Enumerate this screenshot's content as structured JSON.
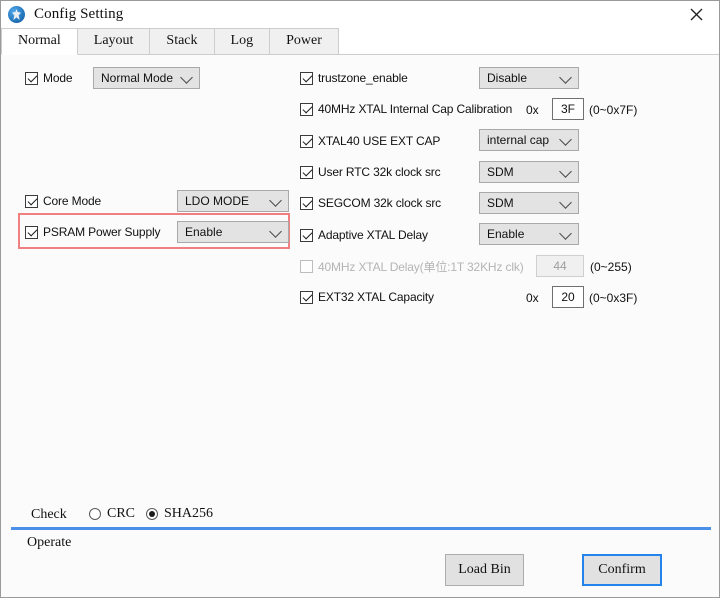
{
  "window": {
    "title": "Config Setting",
    "app_icon": "globe-icon",
    "close_icon": "close-icon"
  },
  "tabs": [
    {
      "label": "Normal",
      "active": true
    },
    {
      "label": "Layout",
      "active": false
    },
    {
      "label": "Stack",
      "active": false
    },
    {
      "label": "Log",
      "active": false
    },
    {
      "label": "Power",
      "active": false
    }
  ],
  "left_column": {
    "mode": {
      "label": "Mode",
      "checked": true,
      "value": "Normal Mode"
    },
    "core_mode": {
      "label": "Core Mode",
      "checked": true,
      "value": "LDO MODE"
    },
    "psram_power_supply": {
      "label": "PSRAM Power Supply",
      "checked": true,
      "value": "Enable",
      "highlight_color": "#f08080"
    }
  },
  "right_column": {
    "trustzone_enable": {
      "label": "trustzone_enable",
      "checked": true,
      "value": "Disable"
    },
    "xtal_internal_cap_calibration": {
      "label": "40MHz XTAL Internal Cap Calibration",
      "checked": true,
      "prefix": "0x",
      "value": "3F",
      "range": "(0~0x7F)"
    },
    "xtal40_use_ext_cap": {
      "label": "XTAL40 USE EXT CAP",
      "checked": true,
      "value": "internal cap"
    },
    "user_rtc_32k_clock_src": {
      "label": "User RTC 32k clock src",
      "checked": true,
      "value": "SDM"
    },
    "segcom_32k_clock_src": {
      "label": "SEGCOM 32k clock src",
      "checked": true,
      "value": "SDM"
    },
    "adaptive_xtal_delay": {
      "label": "Adaptive XTAL Delay",
      "checked": true,
      "value": "Enable"
    },
    "xtal_delay": {
      "label": "40MHz XTAL Delay(单位:1T 32KHz clk)",
      "checked": false,
      "disabled": true,
      "value": "44",
      "range": "(0~255)"
    },
    "ext32_xtal_capacity": {
      "label": "EXT32 XTAL Capacity",
      "checked": true,
      "prefix": "0x",
      "value": "20",
      "range": "(0~0x3F)"
    }
  },
  "check_section": {
    "label": "Check",
    "options": [
      {
        "label": "CRC",
        "selected": false
      },
      {
        "label": "SHA256",
        "selected": true
      }
    ],
    "divider_color": "#4a8fe8"
  },
  "operate_section": {
    "label": "Operate",
    "load_bin_label": "Load Bin",
    "confirm_label": "Confirm",
    "confirm_accent": "#2484ec"
  }
}
